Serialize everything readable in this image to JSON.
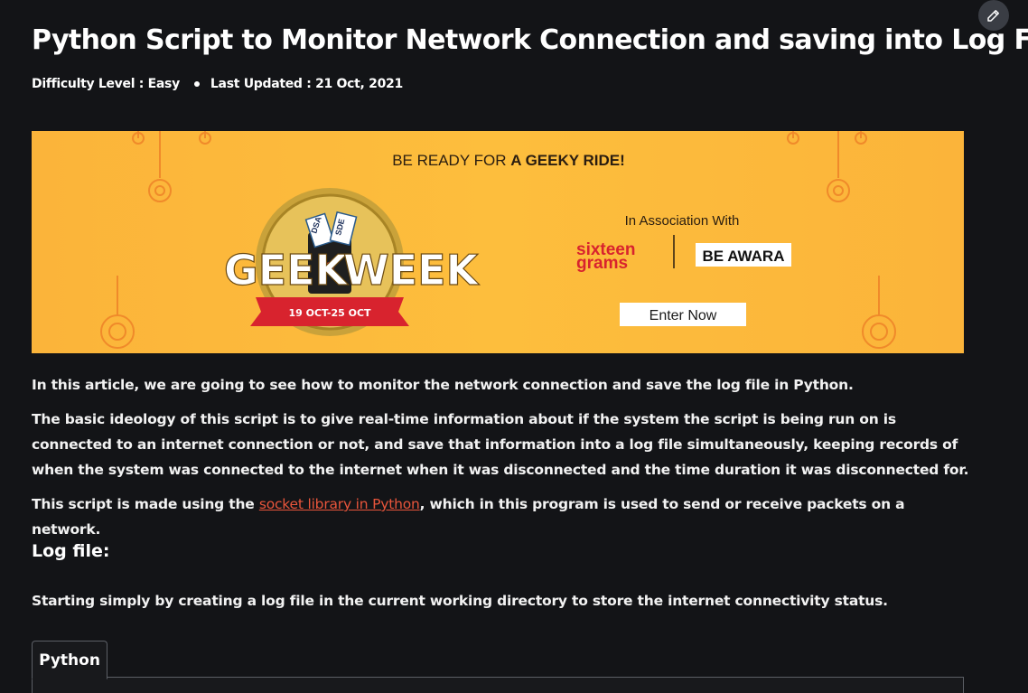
{
  "article": {
    "title": "Python Script to Monitor Network Connection and saving into Log File",
    "difficulty": "Difficulty Level : Easy",
    "updated": "Last Updated : 21 Oct, 2021",
    "edit_icon": "pencil-icon"
  },
  "banner": {
    "tagline_prefix": "BE READY FOR ",
    "tagline_bold": "A GEEKY RIDE!",
    "association": "In Association With",
    "partner1_line1": "sixteen",
    "partner1_line2": "grams",
    "partner2": "BE AWARA",
    "logo_left": "GEEK",
    "logo_right": "WEEK",
    "dates": "19 OCT-25 OCT",
    "ticket1": "DSA",
    "ticket2": "SDE",
    "cta": "Enter Now"
  },
  "content": {
    "p1": "In this article, we are going to see how to monitor the network connection and save the log file in Python.",
    "p2": "The basic ideology of this script is to give real-time information about if the system the script is being run on is connected to an internet connection or not, and save that information into a log file simultaneously, keeping records of when the system was connected to the internet when it was disconnected and the time duration it was disconnected for.",
    "p3_before": "This script is made using the ",
    "p3_link": "socket library in Python",
    "p3_after": ", which in this program is used to send or receive packets on a network.",
    "heading_log": "Log file:",
    "p4": "Starting simply by creating a log file in the current working directory to store the internet connectivity status."
  },
  "code": {
    "tab_label": "Python"
  },
  "colors": {
    "background": "#131417",
    "link": "#e8553b",
    "banner": "#fdbe3d"
  }
}
